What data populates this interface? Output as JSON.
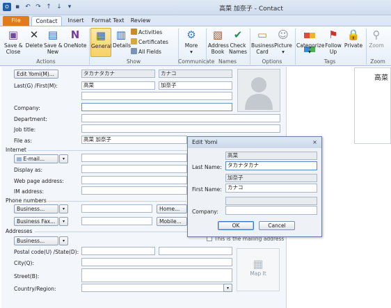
{
  "window": {
    "title": "高菜 加奈子 - Contact"
  },
  "tabs": [
    "File",
    "Contact",
    "Insert",
    "Format Text",
    "Review"
  ],
  "ribbon": {
    "save_close": "Save &\nClose",
    "delete": "Delete",
    "save_new": "Save &\nNew",
    "onenote": "OneNote",
    "general": "General",
    "details": "Details",
    "activities": "Activities",
    "certificates": "Certificates",
    "all_fields": "All Fields",
    "more": "More",
    "address_book": "Address\nBook",
    "check_names": "Check\nNames",
    "business_card": "Business\nCard",
    "picture": "Picture",
    "categorize": "Categorize",
    "follow_up": "Follow\nUp",
    "private": "Private",
    "zoom": "Zoom",
    "groups": [
      "Actions",
      "Show",
      "Communicate",
      "Names",
      "Options",
      "Tags",
      "Zoom"
    ]
  },
  "form": {
    "edit_yomi_button": "Edit Yomi(M)...",
    "yomi_last": "タカナタカナ",
    "yomi_first": "カナコ",
    "last_first_label": "Last(G) /First(M):",
    "last_name": "高菜",
    "first_name": "加奈子",
    "company_label": "Company:",
    "department_label": "Department:",
    "job_title_label": "Job title:",
    "file_as_label": "File as:",
    "file_as_value": "高菜 加奈子",
    "internet_section": "Internet",
    "email_button": "E-mail...",
    "display_as_label": "Display as:",
    "web_page_label": "Web page address:",
    "im_label": "IM address:",
    "phone_section": "Phone numbers",
    "phone_business": "Business...",
    "phone_business_fax": "Business Fax...",
    "phone_home": "Home...",
    "phone_mobile": "Mobile...",
    "addresses_section": "Addresses",
    "address_business": "Business...",
    "mailing_address": "This is the mailing address",
    "postal_label": "Postal code(U) /State(D):",
    "city_label": "City(Q):",
    "street_label": "Street(B):",
    "country_label": "Country/Region:",
    "map_it": "Map It",
    "card_name": "高菜"
  },
  "dialog": {
    "title": "Edit Yomi",
    "close": "×",
    "last_name_label": "Last Name:",
    "last_name_kanji": "高菜",
    "last_name_yomi": "タカナタカナ",
    "first_name_label": "First Name:",
    "first_name_kanji": "加奈子",
    "first_name_yomi": "カナコ",
    "company_label": "Company:",
    "company_value": "",
    "ok": "OK",
    "cancel": "Cancel"
  }
}
